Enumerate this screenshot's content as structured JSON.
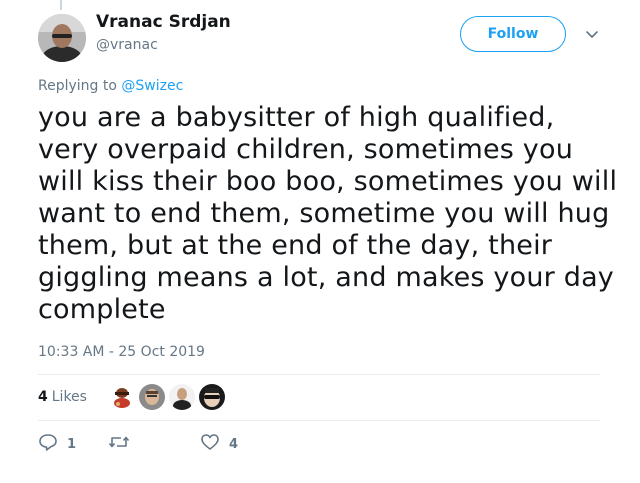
{
  "author": {
    "display_name": "Vranac Srdjan",
    "handle": "@vranac"
  },
  "follow_label": "Follow",
  "reply_context": {
    "prefix": "Replying to",
    "mention": "@Swizec"
  },
  "tweet": {
    "text": "you are a babysitter of high qualified, very overpaid children, sometimes you will kiss their boo boo, sometimes you will want to end them, sometime you will hug them, but at the end of the day, their giggling means a lot, and makes your day complete",
    "timestamp": "10:33 AM - 25 Oct 2019"
  },
  "likes": {
    "count": "4",
    "label": "Likes"
  },
  "actions": {
    "reply_count": "1",
    "retweet_count": "",
    "like_count": "4"
  },
  "colors": {
    "accent": "#1da1f2",
    "muted": "#657786",
    "divider": "#e6ecf0",
    "text": "#14171a"
  },
  "icons": [
    "chevron-down-icon",
    "reply-icon",
    "retweet-icon",
    "heart-icon"
  ]
}
